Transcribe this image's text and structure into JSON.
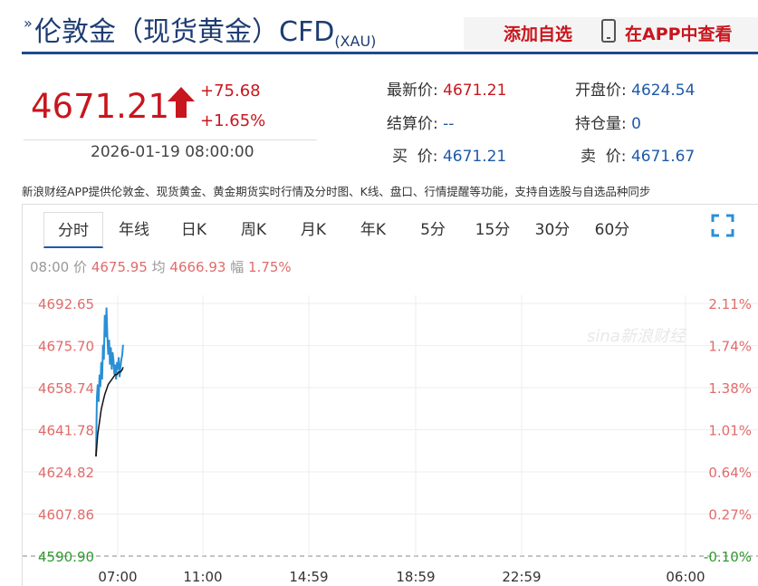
{
  "header": {
    "title": "伦敦金（现货黄金）CFD",
    "symbol": "(XAU)",
    "add_favorite": "添加自选",
    "view_in_app": "在APP中查看"
  },
  "quote": {
    "price": "4671.21",
    "change": "+75.68",
    "change_pct": "+1.65%",
    "datetime": "2026-01-19 08:00:00"
  },
  "stats": {
    "latest_label": "最新价:",
    "latest_value": "4671.21",
    "open_label": "开盘价:",
    "open_value": "4624.54",
    "settle_label": "结算价:",
    "settle_value": "--",
    "oi_label": "持仓量:",
    "oi_value": "0",
    "buy_label": "买  价:",
    "buy_value": "4671.21",
    "sell_label": "卖  价:",
    "sell_value": "4671.67"
  },
  "description": "新浪财经APP提供伦敦金、现货黄金、黄金期货实时行情及分时图、K线、盘口、行情提醒等功能，支持自选股与自选品种同步",
  "tabs": [
    "分时",
    "年线",
    "日K",
    "周K",
    "月K",
    "年K",
    "5分",
    "15分",
    "30分",
    "60分"
  ],
  "active_tab": "分时",
  "info_bar": {
    "time": "08:00",
    "price_label": "价",
    "price_value": "4675.95",
    "avg_label": "均",
    "avg_value": "4666.93",
    "amp_label": "幅",
    "amp_value": "1.75%"
  },
  "watermark": "sina新浪财经",
  "colors": {
    "up": "#c8161e",
    "down": "#2e9b2e",
    "price_line": "#2a8fd6",
    "avg_line": "#111111",
    "accent": "#1e5aa8"
  },
  "chart_data": {
    "type": "line",
    "y_ticks_left": [
      "4692.65",
      "4675.70",
      "4658.74",
      "4641.78",
      "4624.82",
      "4607.86",
      "4590.90"
    ],
    "y_ticks_right": [
      "2.11%",
      "1.74%",
      "1.38%",
      "1.01%",
      "0.64%",
      "0.27%",
      "-0.10%"
    ],
    "x_ticks": [
      "07:00",
      "11:00",
      "14:59",
      "18:59",
      "22:59",
      "06:00"
    ],
    "ylim": [
      4590.9,
      4692.65
    ],
    "x_range": [
      0,
      1380
    ],
    "series": [
      {
        "name": "价",
        "x": [
          0,
          2,
          4,
          6,
          8,
          10,
          12,
          14,
          16,
          18,
          20,
          22,
          24,
          26,
          28,
          30,
          32,
          34,
          36,
          38,
          40,
          42,
          44,
          46,
          48,
          50,
          52,
          54,
          56,
          58,
          60,
          62
        ],
        "y": [
          4631,
          4655,
          4660,
          4653,
          4664,
          4659,
          4669,
          4662,
          4676,
          4670,
          4688,
          4679,
          4691,
          4680,
          4672,
          4678,
          4668,
          4675,
          4666,
          4673,
          4670,
          4664,
          4668,
          4662,
          4669,
          4666,
          4671,
          4663,
          4667,
          4670,
          4672,
          4676
        ]
      },
      {
        "name": "均",
        "x": [
          0,
          4,
          8,
          12,
          16,
          20,
          24,
          28,
          32,
          36,
          40,
          44,
          48,
          52,
          56,
          60,
          62
        ],
        "y": [
          4631,
          4640,
          4645,
          4650,
          4653,
          4656,
          4658,
          4660,
          4661,
          4662,
          4663,
          4664,
          4664,
          4665,
          4665,
          4666,
          4667
        ]
      }
    ],
    "ref_line": 4590.9
  }
}
